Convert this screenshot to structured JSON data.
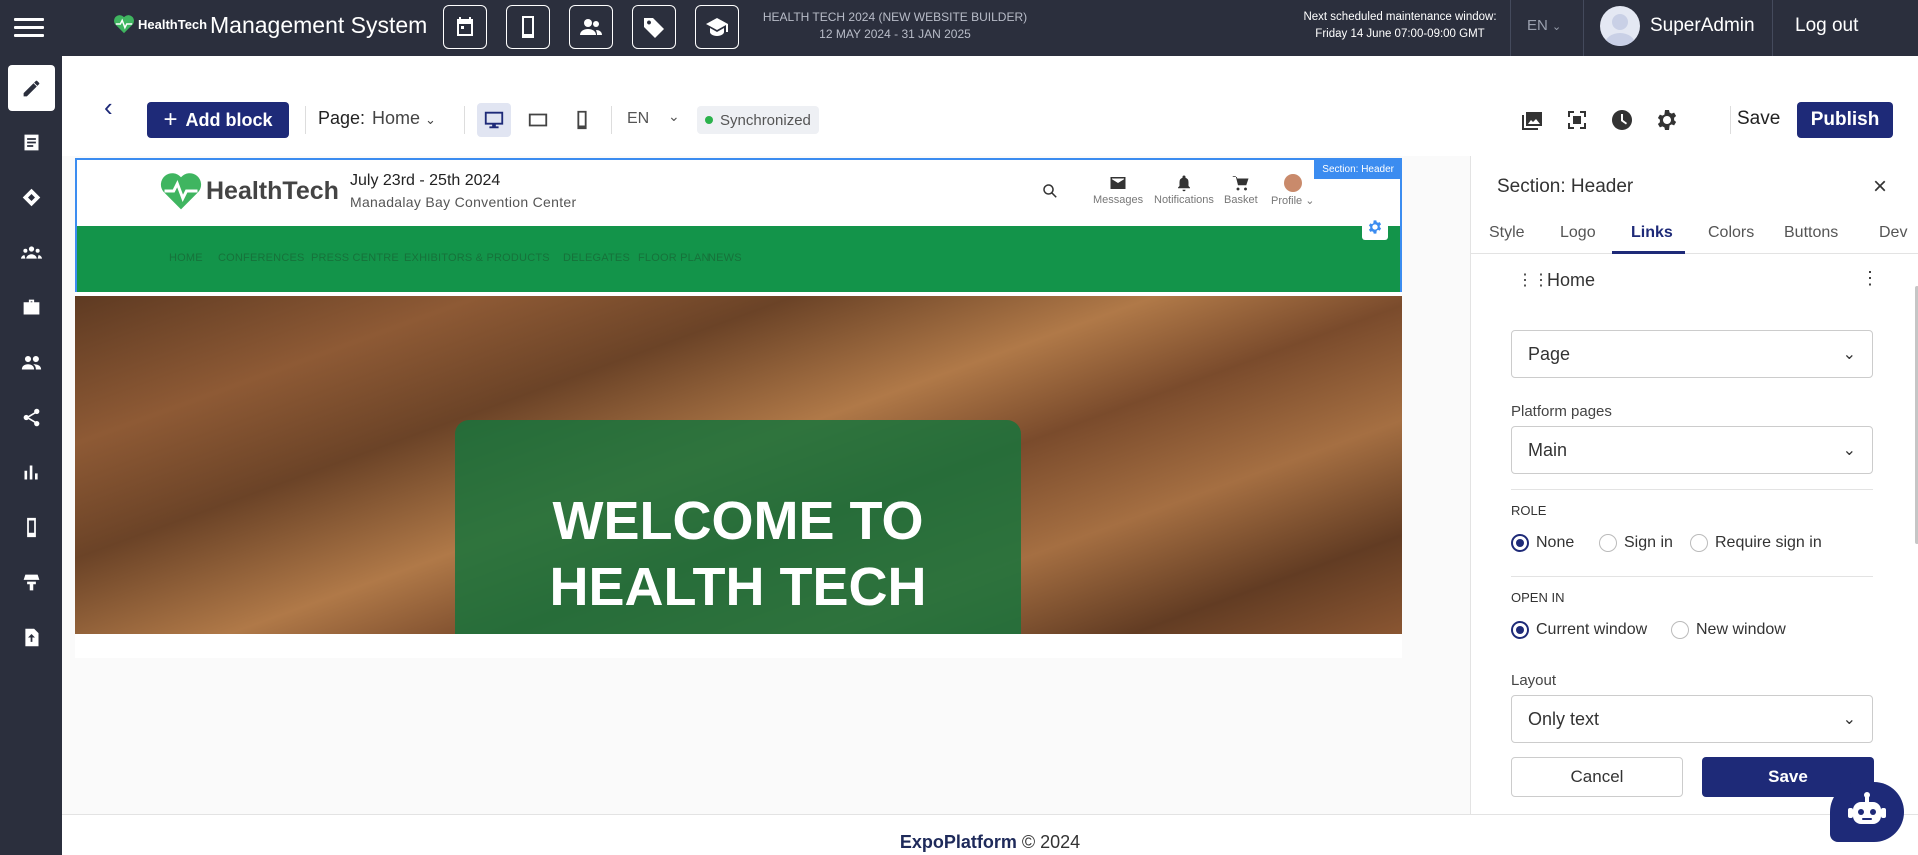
{
  "topbar": {
    "logo_text": "HealthTech",
    "title": "Management System",
    "event_name": "HEALTH TECH 2024 (NEW WEBSITE BUILDER)",
    "event_dates": "12 MAY 2024 - 31 JAN 2025",
    "maintenance_title": "Next scheduled maintenance window:",
    "maintenance_time": "Friday 14 June 07:00-09:00 GMT",
    "language": "EN",
    "username": "SuperAdmin",
    "logout": "Log out",
    "icons": [
      "calendar-icon",
      "tablet-icon",
      "people-icon",
      "tag-icon",
      "graduation-cap-icon"
    ]
  },
  "sidebar": {
    "items": [
      "edit-icon",
      "list-icon",
      "ticket-icon",
      "group-icon",
      "briefcase-icon",
      "users-icon",
      "share-icon",
      "bar-chart-icon",
      "mobile-icon",
      "booth-icon",
      "file-upload-icon"
    ]
  },
  "toolbar": {
    "add_block": "Add block",
    "page_label": "Page:",
    "page_value": "Home",
    "language": "EN",
    "sync_status": "Synchronized",
    "save": "Save",
    "publish": "Publish"
  },
  "preview": {
    "section_tag": "Section: Header",
    "logo_text": "HealthTech",
    "event_date": "July 23rd - 25th 2024",
    "venue": "Manadalay Bay Convention Center",
    "actions": [
      "Messages",
      "Notifications",
      "Basket",
      "Profile"
    ],
    "nav": [
      "HOME",
      "CONFERENCES",
      "PRESS CENTRE",
      "EXHIBITORS & PRODUCTS",
      "DELEGATES",
      "FLOOR PLAN",
      "NEWS"
    ],
    "hero_line1": "WELCOME TO",
    "hero_line2": "HEALTH TECH"
  },
  "panel": {
    "title": "Section: Header",
    "tabs": [
      "Style",
      "Logo",
      "Links",
      "Colors",
      "Buttons",
      "Dev"
    ],
    "active_tab": "Links",
    "link_title": "Home",
    "link_type": "Page",
    "platform_pages_label": "Platform pages",
    "platform_pages_value": "Main",
    "role_label": "ROLE",
    "role_options": [
      "None",
      "Sign in",
      "Require sign in"
    ],
    "role_selected": "None",
    "open_in_label": "OPEN IN",
    "open_in_options": [
      "Current window",
      "New window"
    ],
    "open_in_selected": "Current window",
    "layout_label": "Layout",
    "layout_value": "Only text",
    "cancel": "Cancel",
    "save": "Save"
  },
  "footer": {
    "brand": "ExpoPlatform",
    "copyright": "© 2024"
  },
  "colors": {
    "primary": "#1e2a78",
    "topbar": "#2b2f3d",
    "nav_green": "#13944a",
    "selection_blue": "#3b8cf0",
    "sync_green": "#2bb24c"
  }
}
